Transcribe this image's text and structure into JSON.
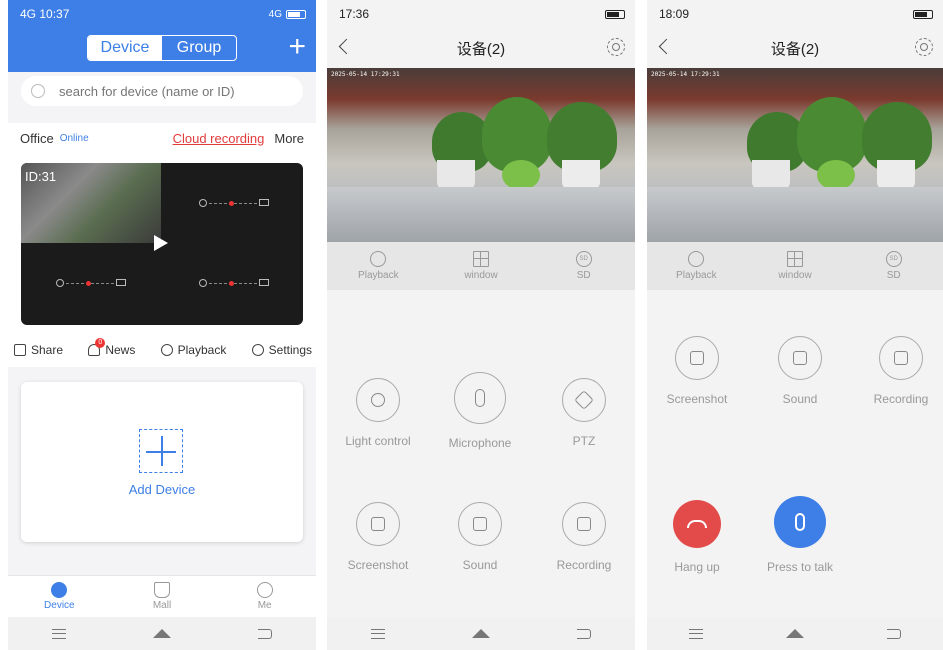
{
  "screen1": {
    "status": {
      "time": "10:37",
      "left_signal": "4G",
      "right_icons": "4G"
    },
    "segment": {
      "device": "Device",
      "group": "Group"
    },
    "search": {
      "placeholder": "search for device (name or ID)"
    },
    "device_group": {
      "name": "Office",
      "status": "Online",
      "cloud": "Cloud recording",
      "more": "More"
    },
    "video": {
      "id_label": "ID:31"
    },
    "actions": {
      "share": "Share",
      "news": "News",
      "news_badge": "0",
      "playback": "Playback",
      "settings": "Settings"
    },
    "add_device": "Add Device",
    "tabs": {
      "device": "Device",
      "mall": "Mall",
      "me": "Me"
    },
    "accent": "#3d7fe6",
    "alert": "#e23b3b"
  },
  "screen2": {
    "status": {
      "time": "17:36"
    },
    "title": "设备(2)",
    "cam_stamp": "2025-05-14 17:29:31",
    "strip": {
      "playback": "Playback",
      "window": "window",
      "sd": "SD"
    },
    "buttons": {
      "light": "Light control",
      "mic": "Microphone",
      "ptz": "PTZ",
      "screenshot": "Screenshot",
      "sound": "Sound",
      "recording": "Recording"
    }
  },
  "screen3": {
    "status": {
      "time": "18:09"
    },
    "title": "设备(2)",
    "cam_stamp": "2025-05-14 17:29:31",
    "strip": {
      "playback": "Playback",
      "window": "window",
      "sd": "SD"
    },
    "buttons": {
      "screenshot": "Screenshot",
      "sound": "Sound",
      "recording": "Recording",
      "hangup": "Hang up",
      "talk": "Press to talk"
    },
    "hangup_color": "#e34b4b",
    "talk_color": "#3d7fe6"
  }
}
